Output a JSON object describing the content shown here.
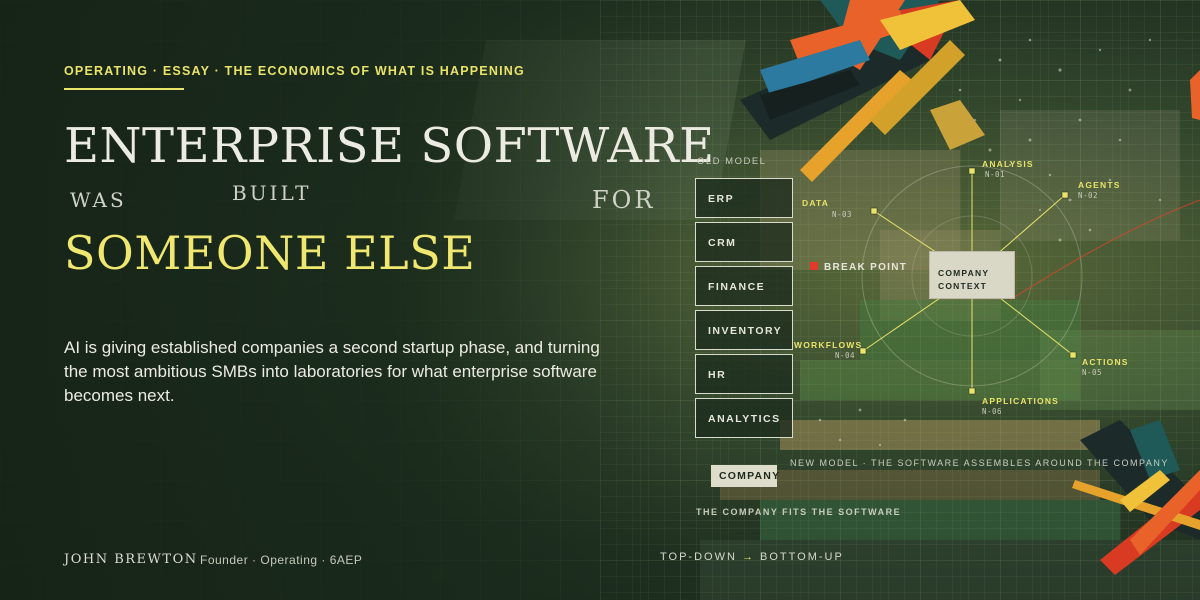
{
  "eyebrow": "OPERATING · ESSAY · THE ECONOMICS OF WHAT IS HAPPENING",
  "headline": {
    "line1": "ENTERPRISE SOFTWARE",
    "word_was": "WAS",
    "word_built": "BUILT",
    "word_for": "FOR",
    "line3": "SOMEONE ELSE"
  },
  "lede": "AI is giving established companies a second startup phase, and turning the most ambitious SMBs into laboratories for what enterprise software becomes next.",
  "author": {
    "name": "JOHN BREWTON",
    "byline": "Founder · Operating · 6AEP"
  },
  "diagram": {
    "old_model_label": "OLD MODEL",
    "stack": [
      "ERP",
      "CRM",
      "FINANCE",
      "INVENTORY",
      "HR",
      "ANALYTICS"
    ],
    "company_chip": "COMPANY",
    "fits_caption": "THE COMPANY FITS THE SOFTWARE",
    "new_model_caption": "NEW MODEL · THE SOFTWARE ASSEMBLES AROUND THE COMPANY",
    "break_point": "BREAK POINT",
    "context_line1": "COMPANY",
    "context_line2": "CONTEXT",
    "nodes": [
      {
        "label": "ANALYSIS",
        "id": "N-01"
      },
      {
        "label": "AGENTS",
        "id": "N-02"
      },
      {
        "label": "DATA",
        "id": "N-03"
      },
      {
        "label": "WORKFLOWS",
        "id": "N-04"
      },
      {
        "label": "ACTIONS",
        "id": "N-05"
      },
      {
        "label": "APPLICATIONS",
        "id": "N-06"
      }
    ],
    "footer_from": "TOP-DOWN",
    "footer_arrow": "→",
    "footer_to": "BOTTOM-UP"
  },
  "colors": {
    "accent": "#e9e36a",
    "background": "#1f3020",
    "text": "#ecebe2",
    "break_point": "#e23a2a"
  }
}
